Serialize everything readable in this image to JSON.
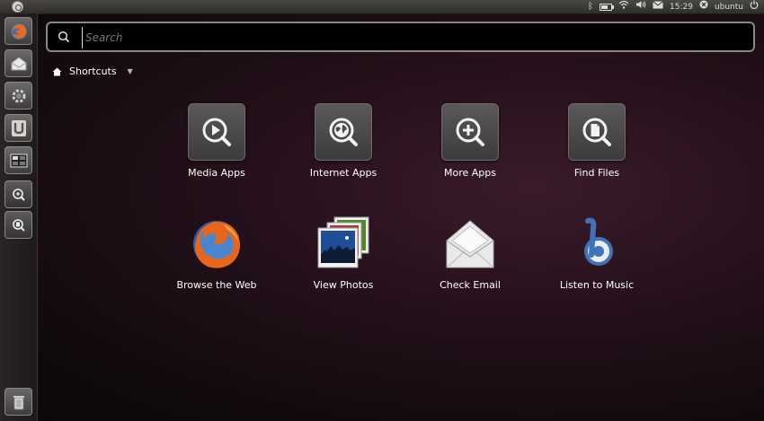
{
  "top_panel": {
    "indicators": {
      "bluetooth_icon": "bluetooth-icon",
      "battery_icon": "battery-icon",
      "wifi_icon": "wifi-icon",
      "volume_icon": "volume-icon",
      "mail_icon": "mail-icon",
      "clock": "15:29",
      "user": "ubuntu",
      "power_icon": "power-icon"
    }
  },
  "launcher": {
    "items": [
      {
        "icon": "firefox-icon"
      },
      {
        "icon": "evolution-mail-icon"
      },
      {
        "icon": "settings-icon"
      },
      {
        "icon": "ubuntu-one-icon"
      },
      {
        "icon": "workspace-switcher-icon"
      },
      {
        "icon": "applications-lens-icon"
      },
      {
        "icon": "files-lens-icon"
      },
      {
        "icon": "trash-icon"
      }
    ]
  },
  "search": {
    "placeholder": "Search",
    "value": ""
  },
  "filter": {
    "label": "Shortcuts"
  },
  "shortcuts": [
    {
      "label": "Media Apps",
      "icon": "media-apps-icon"
    },
    {
      "label": "Internet Apps",
      "icon": "internet-apps-icon"
    },
    {
      "label": "More Apps",
      "icon": "more-apps-icon"
    },
    {
      "label": "Find Files",
      "icon": "find-files-icon"
    },
    {
      "label": "Browse the Web",
      "icon": "firefox-icon"
    },
    {
      "label": "View Photos",
      "icon": "photos-icon"
    },
    {
      "label": "Check Email",
      "icon": "email-icon"
    },
    {
      "label": "Listen to Music",
      "icon": "music-icon"
    }
  ]
}
